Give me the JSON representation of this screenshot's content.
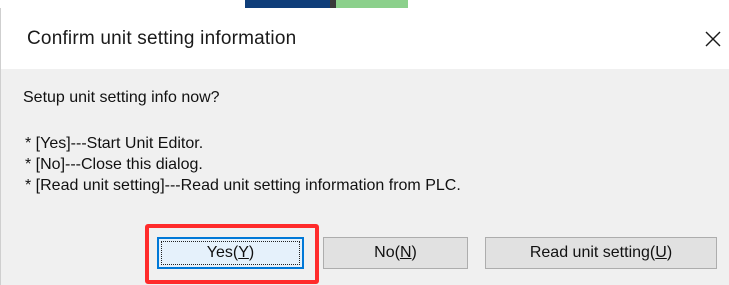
{
  "dialog": {
    "title": "Confirm unit setting information",
    "question": "Setup unit setting info now?",
    "lines": [
      "* [Yes]---Start Unit Editor.",
      "* [No]---Close this dialog.",
      "* [Read unit setting]---Read unit setting information from PLC."
    ],
    "buttons": {
      "yes_prefix": "Yes(",
      "yes_key": "Y",
      "yes_suffix": ")",
      "no_prefix": "No(",
      "no_key": "N",
      "no_suffix": ")",
      "read_prefix": "Read unit setting(",
      "read_key": "U",
      "read_suffix": ")"
    }
  },
  "icons": {
    "close": "close-icon"
  },
  "colors": {
    "highlight": "#ff2b2b",
    "default_button_border": "#0078d7",
    "button_face": "#e1e1e1",
    "dialog_background": "#f0f0f0"
  }
}
